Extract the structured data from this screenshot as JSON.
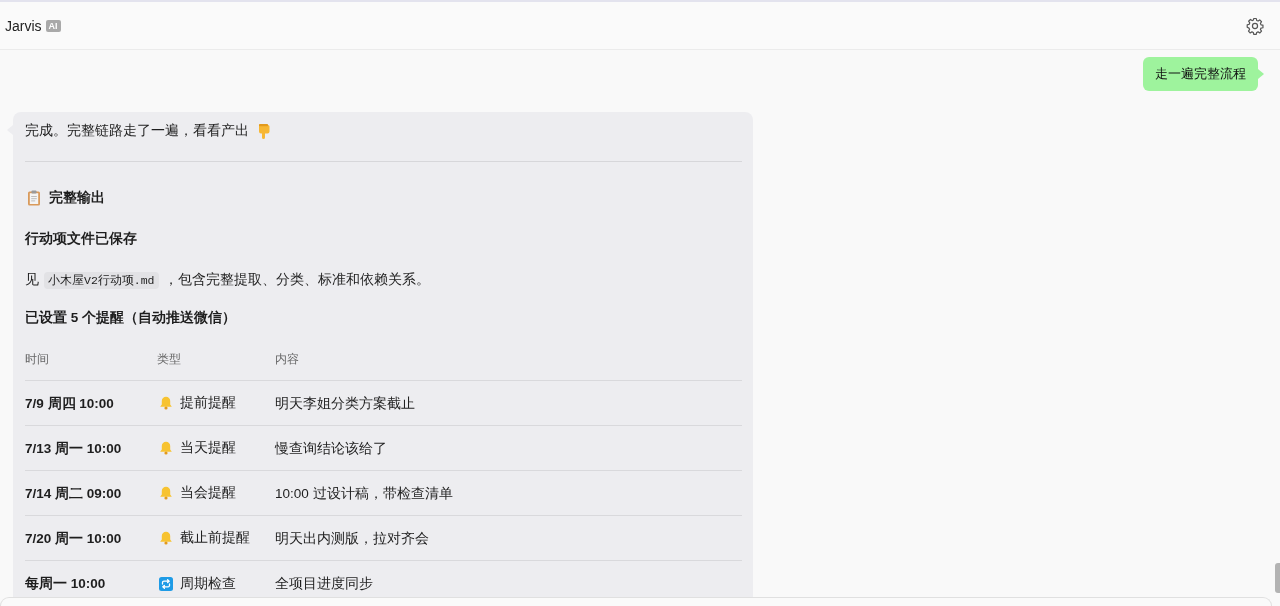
{
  "header": {
    "title": "Jarvis",
    "badge": "AI"
  },
  "user_message": {
    "text": "走一遍完整流程"
  },
  "assistant_message": {
    "intro": "完成。完整链路走了一遍，看看产出",
    "heading": "完整输出",
    "file_note": {
      "title": "行动项文件已保存",
      "before": "见",
      "file_name": "小木屋V2行动项.md",
      "after": "，包含完整提取、分类、标准和依赖关系。"
    },
    "reminders": {
      "title": "已设置 5 个提醒（自动推送微信）",
      "columns": [
        "时间",
        "类型",
        "内容"
      ],
      "rows": [
        {
          "time": "7/9 周四 10:00",
          "kind": "reminder",
          "type": "提前提醒",
          "content": "明天李姐分类方案截止"
        },
        {
          "time": "7/13 周一 10:00",
          "kind": "reminder",
          "type": "当天提醒",
          "content": "慢查询结论该给了"
        },
        {
          "time": "7/14 周二 09:00",
          "kind": "reminder",
          "type": "当会提醒",
          "content": "10:00 过设计稿，带检查清单"
        },
        {
          "time": "7/20 周一 10:00",
          "kind": "reminder",
          "type": "截止前提醒",
          "content": "明天出内测版，拉对齐会"
        },
        {
          "time": "每周一 10:00",
          "kind": "recurring",
          "type": "周期检查",
          "content": "全项目进度同步"
        }
      ]
    }
  }
}
